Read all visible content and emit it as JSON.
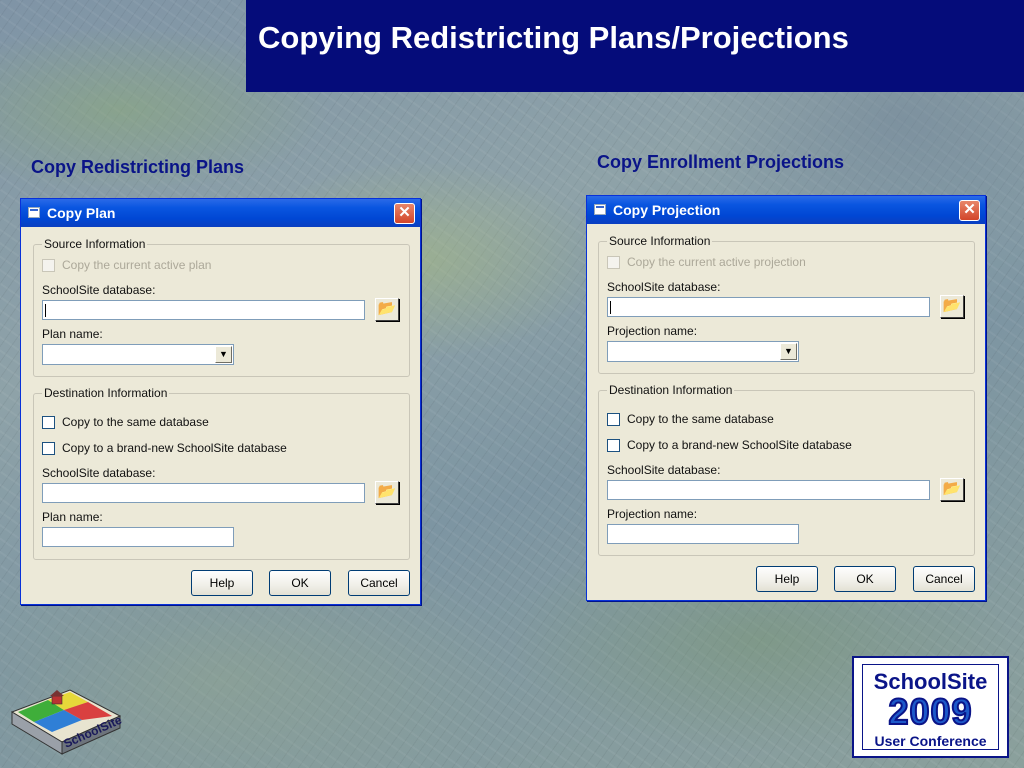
{
  "slide": {
    "title": "Copying Redistricting Plans/Projections",
    "left_heading": "Copy Redistricting Plans",
    "right_heading": "Copy Enrollment Projections"
  },
  "colors": {
    "title_bar": "#050c7a",
    "heading_text": "#0a1488",
    "dialog_face": "#ece9d8",
    "titlebar_blue": "#0047d4",
    "close_red": "#d2452a"
  },
  "plan_dialog": {
    "title": "Copy Plan",
    "close_label": "✕",
    "source_group": "Source Information",
    "copy_active_label": "Copy the current active plan",
    "source_db_label": "SchoolSite database:",
    "source_db_value": "",
    "name_label": "Plan name:",
    "name_value": "",
    "dest_group": "Destination Information",
    "same_db_label": "Copy to the same database",
    "new_db_label": "Copy to a brand-new SchoolSite database",
    "dest_db_label": "SchoolSite database:",
    "dest_db_value": "",
    "dest_name_label": "Plan name:",
    "dest_name_value": "",
    "help": "Help",
    "ok": "OK",
    "cancel": "Cancel"
  },
  "projection_dialog": {
    "title": "Copy Projection",
    "close_label": "✕",
    "source_group": "Source Information",
    "copy_active_label": "Copy the current active projection",
    "source_db_label": "SchoolSite database:",
    "source_db_value": "",
    "name_label": "Projection name:",
    "name_value": "",
    "dest_group": "Destination Information",
    "same_db_label": "Copy to the same database",
    "new_db_label": "Copy to a brand-new SchoolSite database",
    "dest_db_label": "SchoolSite database:",
    "dest_db_value": "",
    "dest_name_label": "Projection name:",
    "dest_name_value": "",
    "help": "Help",
    "ok": "OK",
    "cancel": "Cancel"
  },
  "icons": {
    "browse": "folder-open-icon",
    "dropdown": "chevron-down-icon",
    "dropdown_glyph": "▼",
    "browse_glyph": "📂"
  },
  "logos": {
    "left_text": "SchoolSite",
    "right_top": "SchoolSite",
    "right_year": "2009",
    "right_bottom": "User Conference"
  }
}
